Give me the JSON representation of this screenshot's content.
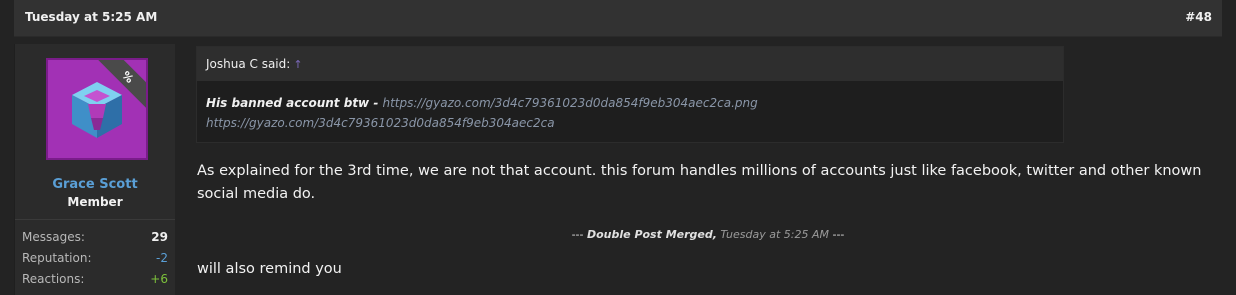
{
  "post": {
    "date": "Tuesday at 5:25 AM",
    "number": "#48"
  },
  "user": {
    "name": "Grace Scott",
    "title": "Member",
    "avatar_badge": "%",
    "stats": [
      {
        "label": "Messages:",
        "value": "29"
      },
      {
        "label": "Reputation:",
        "value": "-2"
      },
      {
        "label": "Reactions:",
        "value": "+6"
      }
    ]
  },
  "quote": {
    "author": "Joshua C said:",
    "arrow": "↑",
    "lead": "His banned account btw - ",
    "link1": "https://gyazo.com/3d4c79361023d0da854f9eb304aec2ca.png",
    "link2": "https://gyazo.com/3d4c79361023d0da854f9eb304aec2ca"
  },
  "message": {
    "text": "As explained for the 3rd time, we are not that account. this forum handles millions of accounts just like facebook, twitter and other known social media do.",
    "merge_prefix": "--- ",
    "merge_label": "Double Post Merged,",
    "merge_time": "Tuesday at 5:25 AM",
    "merge_suffix": " ---",
    "followup": "will also remind you"
  },
  "colors": {
    "accent_link": "#5a9fd6",
    "positive": "#7dc13b",
    "avatar_bg": "#a231b5"
  }
}
